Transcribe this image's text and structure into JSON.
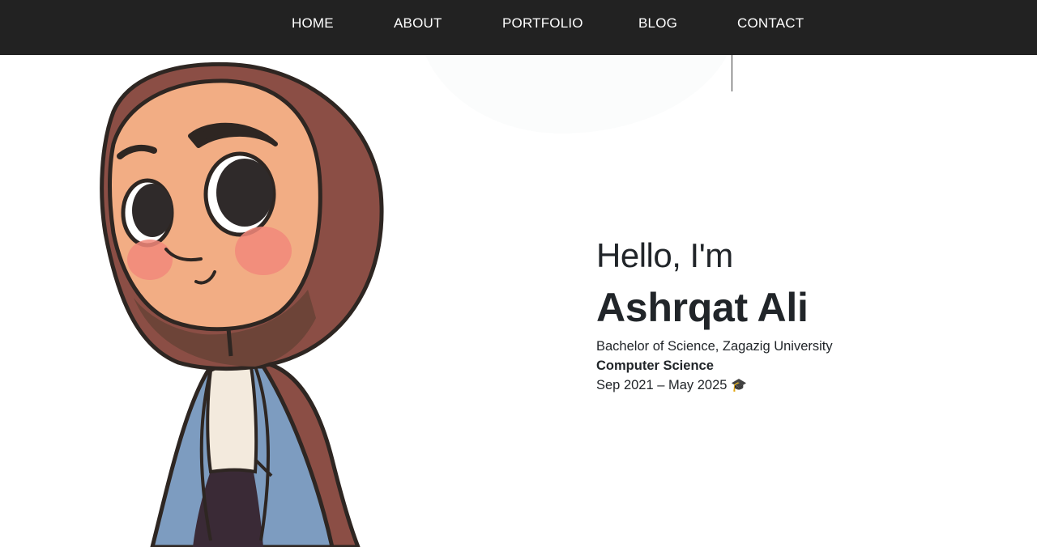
{
  "nav": {
    "items": [
      {
        "label": "HOME"
      },
      {
        "label": "ABOUT"
      },
      {
        "label": "PORTFOLIO"
      },
      {
        "label": "BLOG"
      },
      {
        "label": "CONTACT"
      }
    ]
  },
  "hero": {
    "greeting": "Hello, I'm",
    "name": "Ashrqat Ali",
    "degree": "Bachelor of Science, Zagazig University",
    "major": "Computer Science",
    "dates": "Sep 2021 – May 2025",
    "dates_icon": "graduation-cap-icon",
    "dates_icon_glyph": "🎓"
  },
  "avatar": {
    "icon": "cartoon-girl-avatar"
  },
  "colors": {
    "navbar_bg": "#222222",
    "nav_text": "#ffffff",
    "text": "#212529",
    "hijab": "#8b4e45",
    "skin": "#f2ad84",
    "jacket": "#7d9cc0"
  }
}
